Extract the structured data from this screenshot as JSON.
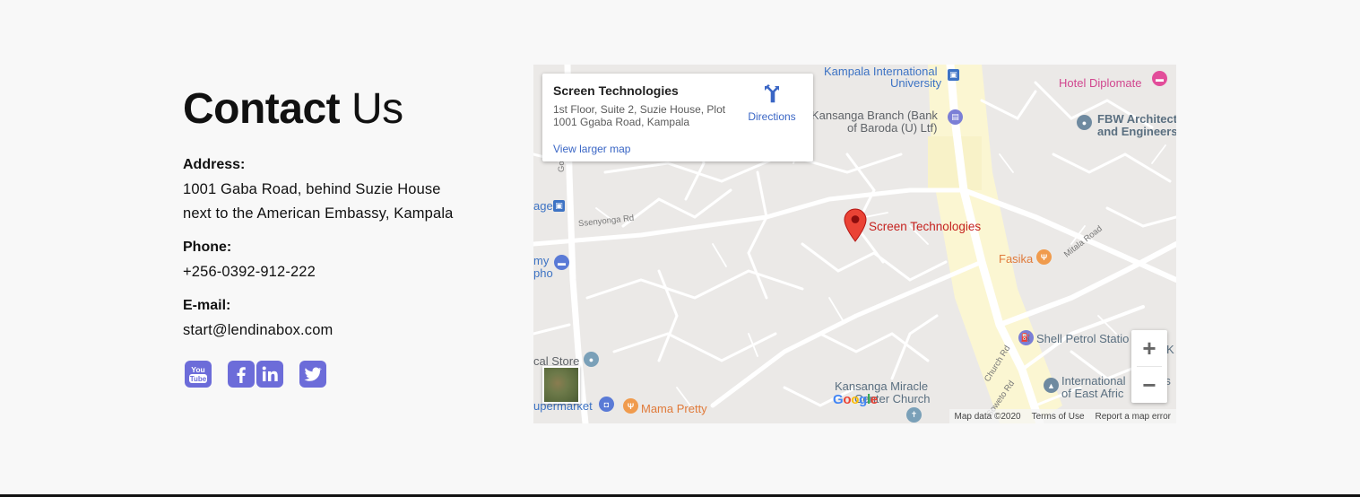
{
  "contact": {
    "title_strong": "Contact",
    "title_light": "Us",
    "address_label": "Address:",
    "address_line1": "1001 Gaba Road, behind Suzie House",
    "address_line2": "next to the American Embassy, Kampala",
    "phone_label": "Phone:",
    "phone_value": "+256-0392-912-222",
    "email_label": "E-mail:",
    "email_value": "start@lendinabox.com",
    "social_icons": [
      "youtube-icon",
      "facebook-icon",
      "linkedin-icon",
      "twitter-icon"
    ],
    "youtube_text": "You Tube",
    "accent_color": "#6c6cd9"
  },
  "map": {
    "card": {
      "place": "Screen Technologies",
      "address_line1": "1st Floor, Suite 2, Suzie House, Plot",
      "address_line2": "1001 Ggaba Road, Kampala",
      "directions_label": "Directions",
      "larger_map_label": "View larger map"
    },
    "marker_label": "Screen Technologies",
    "labels": {
      "kiu_line1": "Kampala International",
      "kiu_line2": "University",
      "hotel": "Hotel Diplomate",
      "bank_line1": "Kansanga Branch (Bank",
      "bank_line2": "of Baroda (U) Ltf)",
      "fbw_line1": "FBW Architect",
      "fbw_line2": "and Engineers",
      "age": "age",
      "ssenyonga": "Ssenyonga Rd",
      "gogonya": "Gogonya",
      "my_line1": "my",
      "my_line2": "pho",
      "fasika": "Fasika",
      "mitala": "Mitala Road",
      "cal_store": "cal Store",
      "supermarket": "upermarket",
      "mama": "Mama Pretty",
      "shell": "Shell Petrol Statio",
      "church_rd": "Church Rd",
      "soweto": "Soweto Rd",
      "kansanga_line1": "Kansanga Miracle",
      "kansanga_line2": "Center Church",
      "intl_line1": "International",
      "intl_line2": "of East Afric",
      "k_edge": "K",
      "rs": "rs"
    },
    "google_logo": [
      "G",
      "o",
      "o",
      "g",
      "l",
      "e"
    ],
    "google_colors": [
      "#4285f4",
      "#ea4335",
      "#fbbc05",
      "#4285f4",
      "#34a853",
      "#ea4335"
    ],
    "attribution": {
      "map_data": "Map data ©2020",
      "terms": "Terms of Use",
      "report": "Report a map error"
    },
    "zoom_in": "+",
    "zoom_out": "−"
  }
}
